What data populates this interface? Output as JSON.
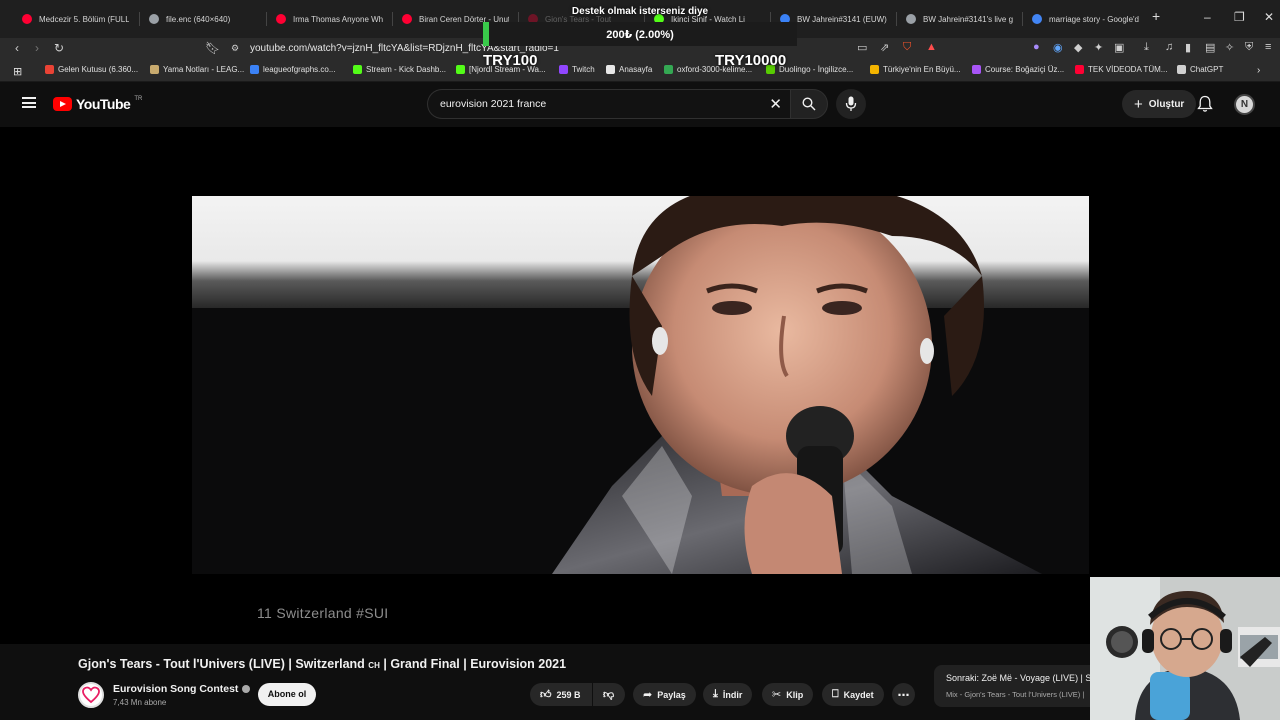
{
  "browser": {
    "tabs": [
      {
        "title": "Medcezir 5. Bölüm (FULL H",
        "color": "#ff0033"
      },
      {
        "title": "file.enc (640×640)",
        "color": "#9aa0a6"
      },
      {
        "title": "Irma Thomas Anyone Who",
        "color": "#ff0033"
      },
      {
        "title": "Biran Ceren Dörter - Unuti",
        "color": "#ff0033"
      },
      {
        "title": "Gjon's Tears - Tout",
        "color": "#ff0033"
      },
      {
        "title": "Ikinci Sinif - Watch Li",
        "color": "#53fc18"
      },
      {
        "title": "BW Jahrein#3141 (EUW)",
        "color": "#3b82f6"
      },
      {
        "title": "BW Jahrein#3141's live ga",
        "color": "#9aa0a6"
      },
      {
        "title": "marriage story - Google'd",
        "color": "#4285f4"
      }
    ],
    "new_tab_label": "+",
    "url": "youtube.com/watch?v=jznH_fltcYA&list=RDjznH_fltcYA&start_radio=1",
    "bookmarks": [
      {
        "label": "Gelen Kutusu (6.360...",
        "color": "#ea4335"
      },
      {
        "label": "Yama Notları - LEAG...",
        "color": "#c8aa6e"
      },
      {
        "label": "leagueofgraphs.co...",
        "color": "#3b82f6"
      },
      {
        "label": "Stream - Kick Dashb...",
        "color": "#53fc18"
      },
      {
        "label": "[Njordl Stream - Wa...",
        "color": "#53fc18"
      },
      {
        "label": "Twitch",
        "color": "#9146ff"
      },
      {
        "label": "Anasayfa",
        "color": "#e7e7e7"
      },
      {
        "label": "oxford-3000-kelime...",
        "color": "#34a853"
      },
      {
        "label": "Duolingo - İngilizce...",
        "color": "#58cc02"
      },
      {
        "label": "Türkiye'nin En Büyü...",
        "color": "#f4b400"
      },
      {
        "label": "Course: Boğaziçi Üz...",
        "color": "#a855f7"
      },
      {
        "label": "TEK VİDEODA TÜM...",
        "color": "#ff0033"
      },
      {
        "label": "ChatGPT",
        "color": "#d0d0d0"
      }
    ]
  },
  "overlay": {
    "title": "Destek olmak isterseniz diye",
    "progress_text": "200₺ (2.00%)",
    "progress_percent": 2,
    "goal_min": "TRY100",
    "goal_max": "TRY10000"
  },
  "youtube": {
    "logo_text": "YouTube",
    "country": "TR",
    "search_value": "eurovision 2021 france",
    "create_label": "Oluştur",
    "avatar_letter": "N"
  },
  "video": {
    "caption": "11 Switzerland #SUI",
    "title": "Gjon's Tears - Tout l'Univers (LIVE) | Switzerland",
    "title_flag": "CH",
    "title_rest": "| Grand Final | Eurovision 2021",
    "channel": "Eurovision Song Contest",
    "subscribers": "7,43 Mn abone",
    "subscribe_label": "Abone ol",
    "likes": "259 B",
    "share_label": "Paylaş",
    "download_label": "İndir",
    "clip_label": "Klip",
    "save_label": "Kaydet",
    "next_title": "Sonraki: Zoë Më - Voyage (LIVE) | S",
    "next_sub": "Mix - Gjon's Tears - Tout l'Univers (LIVE) |"
  }
}
